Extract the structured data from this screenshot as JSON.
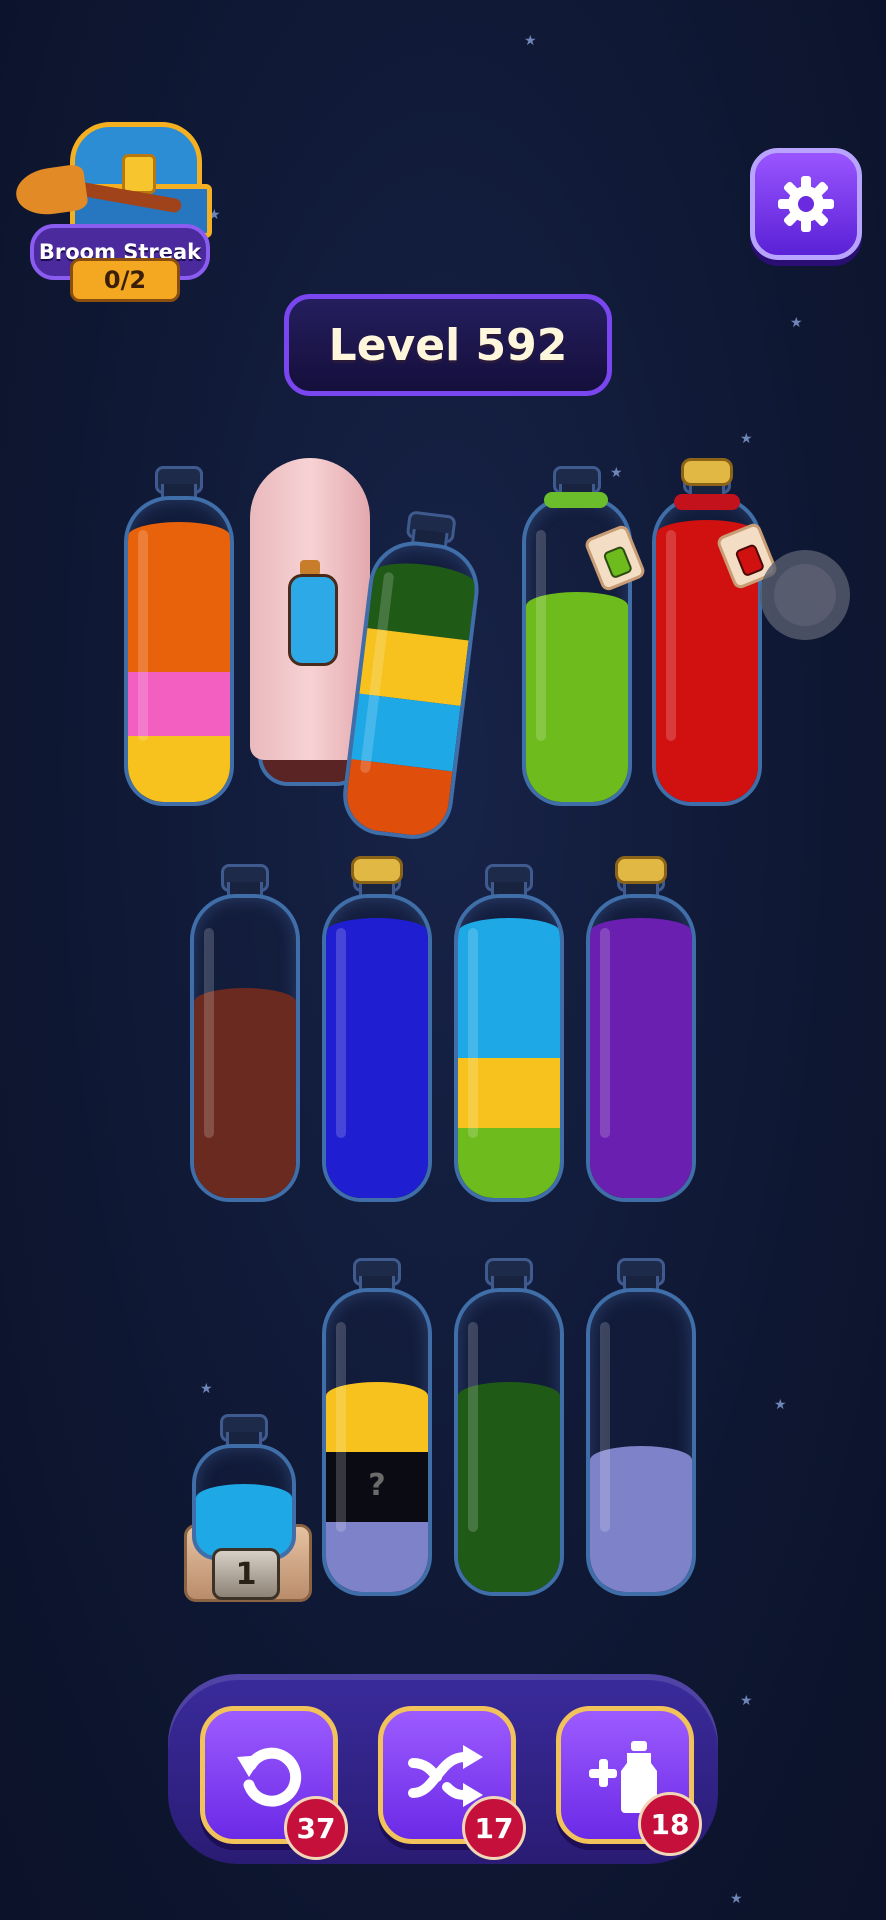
{
  "header": {
    "broom_streak_label": "Broom Streak",
    "broom_streak_count": "0/2",
    "level_label": "Level 592",
    "settings_icon": "gear-icon"
  },
  "colors": {
    "orange": "#e8620c",
    "pink": "#f25fc0",
    "yellow": "#f7c21e",
    "dark_green": "#1f5a16",
    "sky_blue": "#1ea8e6",
    "light_green": "#6dbb1d",
    "red": "#d11010",
    "brown": "#6b2a20",
    "blue": "#1f1ed0",
    "purple": "#6b1fb0",
    "lavender": "#7e82c8",
    "black": "#0b0b14"
  },
  "bottles_row1": [
    {
      "id": "b1",
      "layers": [
        "yellow",
        "pink",
        "orange",
        "orange"
      ]
    },
    {
      "id": "b2",
      "covered": true
    },
    {
      "id": "b3",
      "layers": [
        "orange",
        "sky_blue",
        "yellow",
        "dark_green"
      ],
      "tilted": true
    },
    {
      "id": "b4",
      "layers": [
        "light_green",
        "light_green",
        "light_green"
      ],
      "locked": true
    },
    {
      "id": "b5",
      "layers": [
        "red",
        "red",
        "red",
        "red"
      ],
      "corked": true,
      "locked": true
    }
  ],
  "bottles_row2": [
    {
      "id": "b6",
      "layers": [
        "brown",
        "brown",
        "brown"
      ]
    },
    {
      "id": "b7",
      "layers": [
        "blue",
        "blue",
        "blue",
        "blue"
      ],
      "corked": true
    },
    {
      "id": "b8",
      "layers": [
        "light_green",
        "yellow",
        "sky_blue",
        "sky_blue"
      ]
    },
    {
      "id": "b9",
      "layers": [
        "purple",
        "purple",
        "purple",
        "purple"
      ],
      "corked": true
    }
  ],
  "bottles_row3": [
    {
      "id": "b10",
      "layers": [
        "sky_blue"
      ],
      "small": true,
      "pedestal_number": "1"
    },
    {
      "id": "b11",
      "layers": [
        "lavender",
        "black",
        "yellow"
      ],
      "hidden_symbol": "?"
    },
    {
      "id": "b12",
      "layers": [
        "dark_green",
        "dark_green",
        "dark_green"
      ]
    },
    {
      "id": "b13",
      "layers": [
        "lavender",
        "lavender"
      ]
    }
  ],
  "powerups": [
    {
      "name": "undo",
      "icon": "undo-icon",
      "count": "37"
    },
    {
      "name": "shuffle",
      "icon": "shuffle-icon",
      "count": "17"
    },
    {
      "name": "add-bottle",
      "icon": "add-bottle-icon",
      "count": "18"
    }
  ]
}
